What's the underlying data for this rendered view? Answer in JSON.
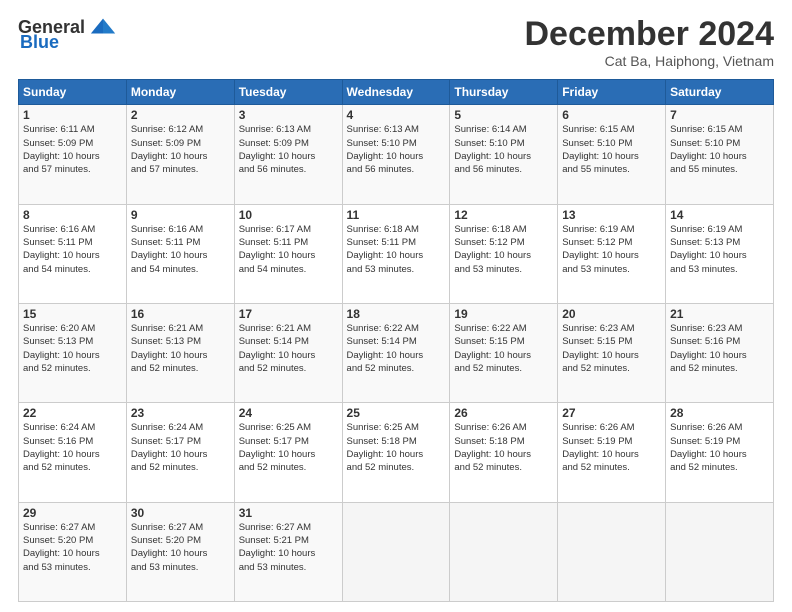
{
  "logo": {
    "general": "General",
    "blue": "Blue"
  },
  "title": {
    "month": "December 2024",
    "location": "Cat Ba, Haiphong, Vietnam"
  },
  "headers": [
    "Sunday",
    "Monday",
    "Tuesday",
    "Wednesday",
    "Thursday",
    "Friday",
    "Saturday"
  ],
  "weeks": [
    [
      {
        "day": "1",
        "info": "Sunrise: 6:11 AM\nSunset: 5:09 PM\nDaylight: 10 hours\nand 57 minutes."
      },
      {
        "day": "2",
        "info": "Sunrise: 6:12 AM\nSunset: 5:09 PM\nDaylight: 10 hours\nand 57 minutes."
      },
      {
        "day": "3",
        "info": "Sunrise: 6:13 AM\nSunset: 5:09 PM\nDaylight: 10 hours\nand 56 minutes."
      },
      {
        "day": "4",
        "info": "Sunrise: 6:13 AM\nSunset: 5:10 PM\nDaylight: 10 hours\nand 56 minutes."
      },
      {
        "day": "5",
        "info": "Sunrise: 6:14 AM\nSunset: 5:10 PM\nDaylight: 10 hours\nand 56 minutes."
      },
      {
        "day": "6",
        "info": "Sunrise: 6:15 AM\nSunset: 5:10 PM\nDaylight: 10 hours\nand 55 minutes."
      },
      {
        "day": "7",
        "info": "Sunrise: 6:15 AM\nSunset: 5:10 PM\nDaylight: 10 hours\nand 55 minutes."
      }
    ],
    [
      {
        "day": "8",
        "info": "Sunrise: 6:16 AM\nSunset: 5:11 PM\nDaylight: 10 hours\nand 54 minutes."
      },
      {
        "day": "9",
        "info": "Sunrise: 6:16 AM\nSunset: 5:11 PM\nDaylight: 10 hours\nand 54 minutes."
      },
      {
        "day": "10",
        "info": "Sunrise: 6:17 AM\nSunset: 5:11 PM\nDaylight: 10 hours\nand 54 minutes."
      },
      {
        "day": "11",
        "info": "Sunrise: 6:18 AM\nSunset: 5:11 PM\nDaylight: 10 hours\nand 53 minutes."
      },
      {
        "day": "12",
        "info": "Sunrise: 6:18 AM\nSunset: 5:12 PM\nDaylight: 10 hours\nand 53 minutes."
      },
      {
        "day": "13",
        "info": "Sunrise: 6:19 AM\nSunset: 5:12 PM\nDaylight: 10 hours\nand 53 minutes."
      },
      {
        "day": "14",
        "info": "Sunrise: 6:19 AM\nSunset: 5:13 PM\nDaylight: 10 hours\nand 53 minutes."
      }
    ],
    [
      {
        "day": "15",
        "info": "Sunrise: 6:20 AM\nSunset: 5:13 PM\nDaylight: 10 hours\nand 52 minutes."
      },
      {
        "day": "16",
        "info": "Sunrise: 6:21 AM\nSunset: 5:13 PM\nDaylight: 10 hours\nand 52 minutes."
      },
      {
        "day": "17",
        "info": "Sunrise: 6:21 AM\nSunset: 5:14 PM\nDaylight: 10 hours\nand 52 minutes."
      },
      {
        "day": "18",
        "info": "Sunrise: 6:22 AM\nSunset: 5:14 PM\nDaylight: 10 hours\nand 52 minutes."
      },
      {
        "day": "19",
        "info": "Sunrise: 6:22 AM\nSunset: 5:15 PM\nDaylight: 10 hours\nand 52 minutes."
      },
      {
        "day": "20",
        "info": "Sunrise: 6:23 AM\nSunset: 5:15 PM\nDaylight: 10 hours\nand 52 minutes."
      },
      {
        "day": "21",
        "info": "Sunrise: 6:23 AM\nSunset: 5:16 PM\nDaylight: 10 hours\nand 52 minutes."
      }
    ],
    [
      {
        "day": "22",
        "info": "Sunrise: 6:24 AM\nSunset: 5:16 PM\nDaylight: 10 hours\nand 52 minutes."
      },
      {
        "day": "23",
        "info": "Sunrise: 6:24 AM\nSunset: 5:17 PM\nDaylight: 10 hours\nand 52 minutes."
      },
      {
        "day": "24",
        "info": "Sunrise: 6:25 AM\nSunset: 5:17 PM\nDaylight: 10 hours\nand 52 minutes."
      },
      {
        "day": "25",
        "info": "Sunrise: 6:25 AM\nSunset: 5:18 PM\nDaylight: 10 hours\nand 52 minutes."
      },
      {
        "day": "26",
        "info": "Sunrise: 6:26 AM\nSunset: 5:18 PM\nDaylight: 10 hours\nand 52 minutes."
      },
      {
        "day": "27",
        "info": "Sunrise: 6:26 AM\nSunset: 5:19 PM\nDaylight: 10 hours\nand 52 minutes."
      },
      {
        "day": "28",
        "info": "Sunrise: 6:26 AM\nSunset: 5:19 PM\nDaylight: 10 hours\nand 52 minutes."
      }
    ],
    [
      {
        "day": "29",
        "info": "Sunrise: 6:27 AM\nSunset: 5:20 PM\nDaylight: 10 hours\nand 53 minutes."
      },
      {
        "day": "30",
        "info": "Sunrise: 6:27 AM\nSunset: 5:20 PM\nDaylight: 10 hours\nand 53 minutes."
      },
      {
        "day": "31",
        "info": "Sunrise: 6:27 AM\nSunset: 5:21 PM\nDaylight: 10 hours\nand 53 minutes."
      },
      {
        "day": "",
        "info": ""
      },
      {
        "day": "",
        "info": ""
      },
      {
        "day": "",
        "info": ""
      },
      {
        "day": "",
        "info": ""
      }
    ]
  ]
}
